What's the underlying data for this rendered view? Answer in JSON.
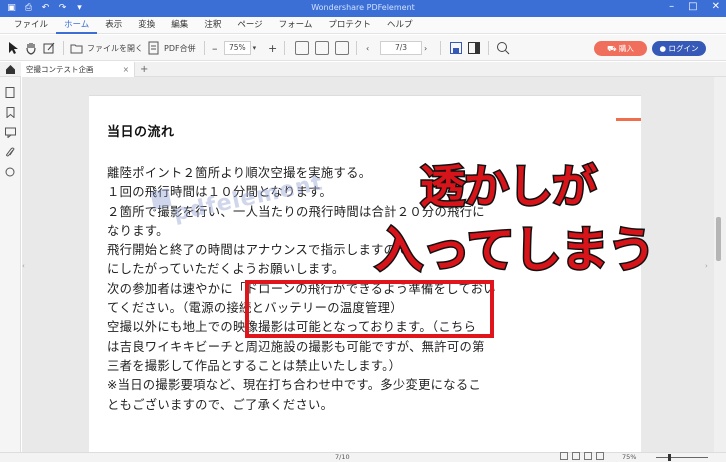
{
  "window": {
    "title": "Wondershare PDFelement",
    "quick_access": [
      "save-icon",
      "print-icon",
      "undo-icon",
      "redo-icon",
      "dropdown-icon"
    ]
  },
  "menu": {
    "items": [
      "ファイル",
      "ホーム",
      "表示",
      "変換",
      "編集",
      "注釈",
      "ページ",
      "フォーム",
      "プロテクト",
      "ヘルプ"
    ],
    "active": "ホーム"
  },
  "toolbar": {
    "open_file_label": "ファイルを開く",
    "pdf_merge_label": "PDF合併",
    "zoom_value": "75%",
    "page_value": "7/3",
    "buy_label": "購入",
    "login_label": "ログイン"
  },
  "tabs": {
    "document_tab": "空撮コンテスト企画"
  },
  "document": {
    "heading": "当日の流れ",
    "lines": [
      "離陸ポイント２箇所より順次空撮を実施する。",
      "１回の飛行時間は１０分間となります。",
      "２箇所で撮影を行い、一人当たりの飛行時間は合計２０分の飛行に",
      "なります。",
      "飛行開始と終了の時間はアナウンスで指示しますので、",
      "にしたがっていただくようお願いします。",
      "次の参加者は速やかに「ドローンの飛行ができるよう準備をしておい",
      "てください。（電源の接続とバッテリーの温度管理）",
      "空撮以外にも地上での映像撮影は可能となっております。（こちら",
      "は吉良ワイキキビーチと周辺施設の撮影も可能ですが、無許可の第",
      "三者を撮影して作品とすることは禁止いたします。）",
      "※当日の撮影要項など、現在打ち合わせ中です。多少変更になるこ",
      "ともございますので、ご了承ください。"
    ],
    "watermark": "pdfelement"
  },
  "annotation": {
    "line1": "透かしが",
    "line2": "入ってしまう",
    "color": "#d6141a"
  },
  "statusbar": {
    "page": "7/10",
    "zoom": "75%"
  },
  "colors": {
    "titlebar": "#3c6fd6",
    "buy_button": "#ef6f5c",
    "login_button": "#3659b8",
    "highlight_box": "#e0141b"
  }
}
